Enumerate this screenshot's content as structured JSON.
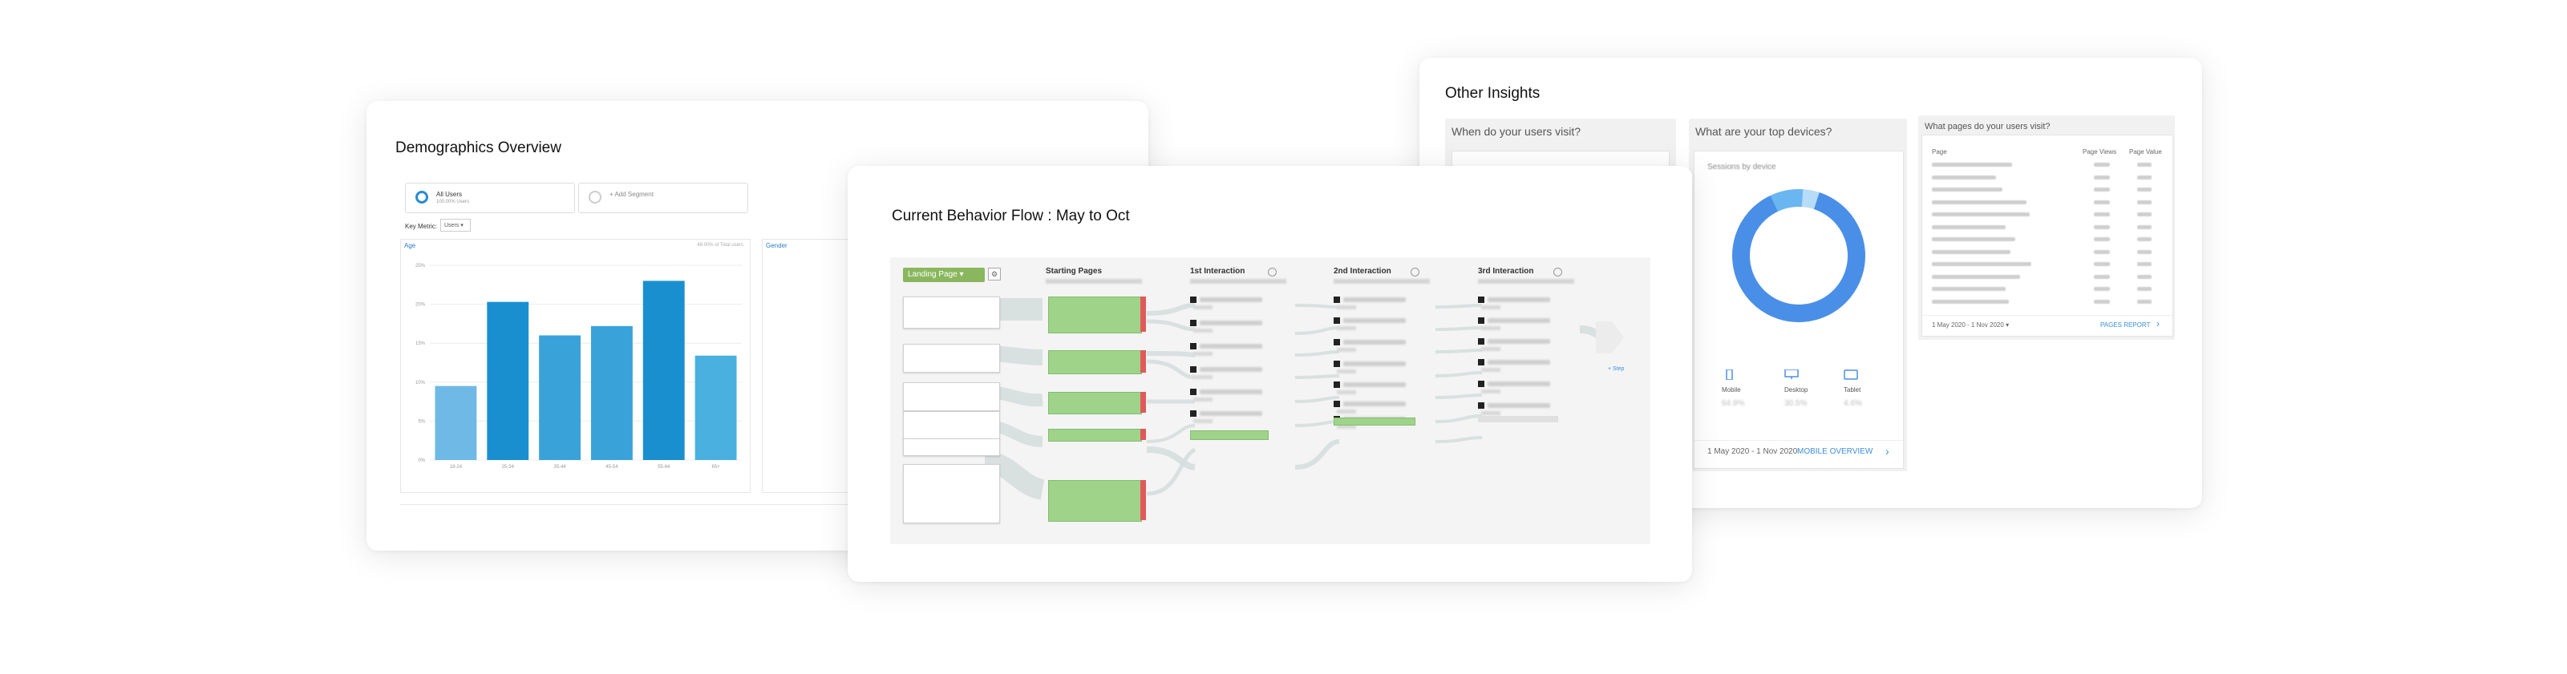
{
  "demographics": {
    "title": "Demographics Overview",
    "segment_all": "All Users",
    "segment_all_sub": "100.00% Users",
    "segment_add": "+ Add Segment",
    "key_metric_label": "Key Metric:",
    "key_metric_value": "Users",
    "age_title": "Age",
    "age_note": "48.00% of Total users",
    "gender_title": "Gender",
    "age_chart": {
      "y_ticks": [
        "25%",
        "20%",
        "15%",
        "10%",
        "5%",
        "0%"
      ],
      "categories": [
        "18-24",
        "25-34",
        "35-44",
        "45-54",
        "55-64",
        "65+"
      ],
      "values": [
        9.5,
        20.3,
        16.0,
        17.2,
        23.0,
        13.4
      ],
      "ymax": 25,
      "colors": [
        "#6fb9e6",
        "#1a8fcf",
        "#39a3d9",
        "#39a3d9",
        "#1a8fcf",
        "#4ab0df"
      ]
    }
  },
  "insights": {
    "title": "Other Insights",
    "when_title": "When do your users visit?",
    "devices_title": "What are your top devices?",
    "pages_title": "What pages do your users visit?",
    "sessions_label": "Sessions by device",
    "donut": {
      "values": [
        88,
        8,
        4
      ],
      "colors": [
        "#4a8fe7",
        "#6ab6f0",
        "#b7dcf7"
      ]
    },
    "devices": [
      {
        "name": "Mobile",
        "value": "64.9%",
        "icon": "mobile-icon"
      },
      {
        "name": "Desktop",
        "value": "30.5%",
        "icon": "desktop-icon"
      },
      {
        "name": "Tablet",
        "value": "4.6%",
        "icon": "tablet-icon"
      }
    ],
    "device_date": "1 May 2020 - 1 Nov 2020",
    "device_link": "MOBILE OVERVIEW",
    "pages_head": {
      "page": "Page",
      "views": "Page Views",
      "value": "Page Value"
    },
    "pages_date": "1 May 2020 - 1 Nov 2020",
    "pages_link": "PAGES REPORT"
  },
  "flow": {
    "title": "Current Behavior Flow : May to Oct",
    "landing_label": "Landing Page",
    "columns": [
      "Starting Pages",
      "1st Interaction",
      "2nd Interaction",
      "3rd Interaction"
    ],
    "more": "+ Step"
  }
}
